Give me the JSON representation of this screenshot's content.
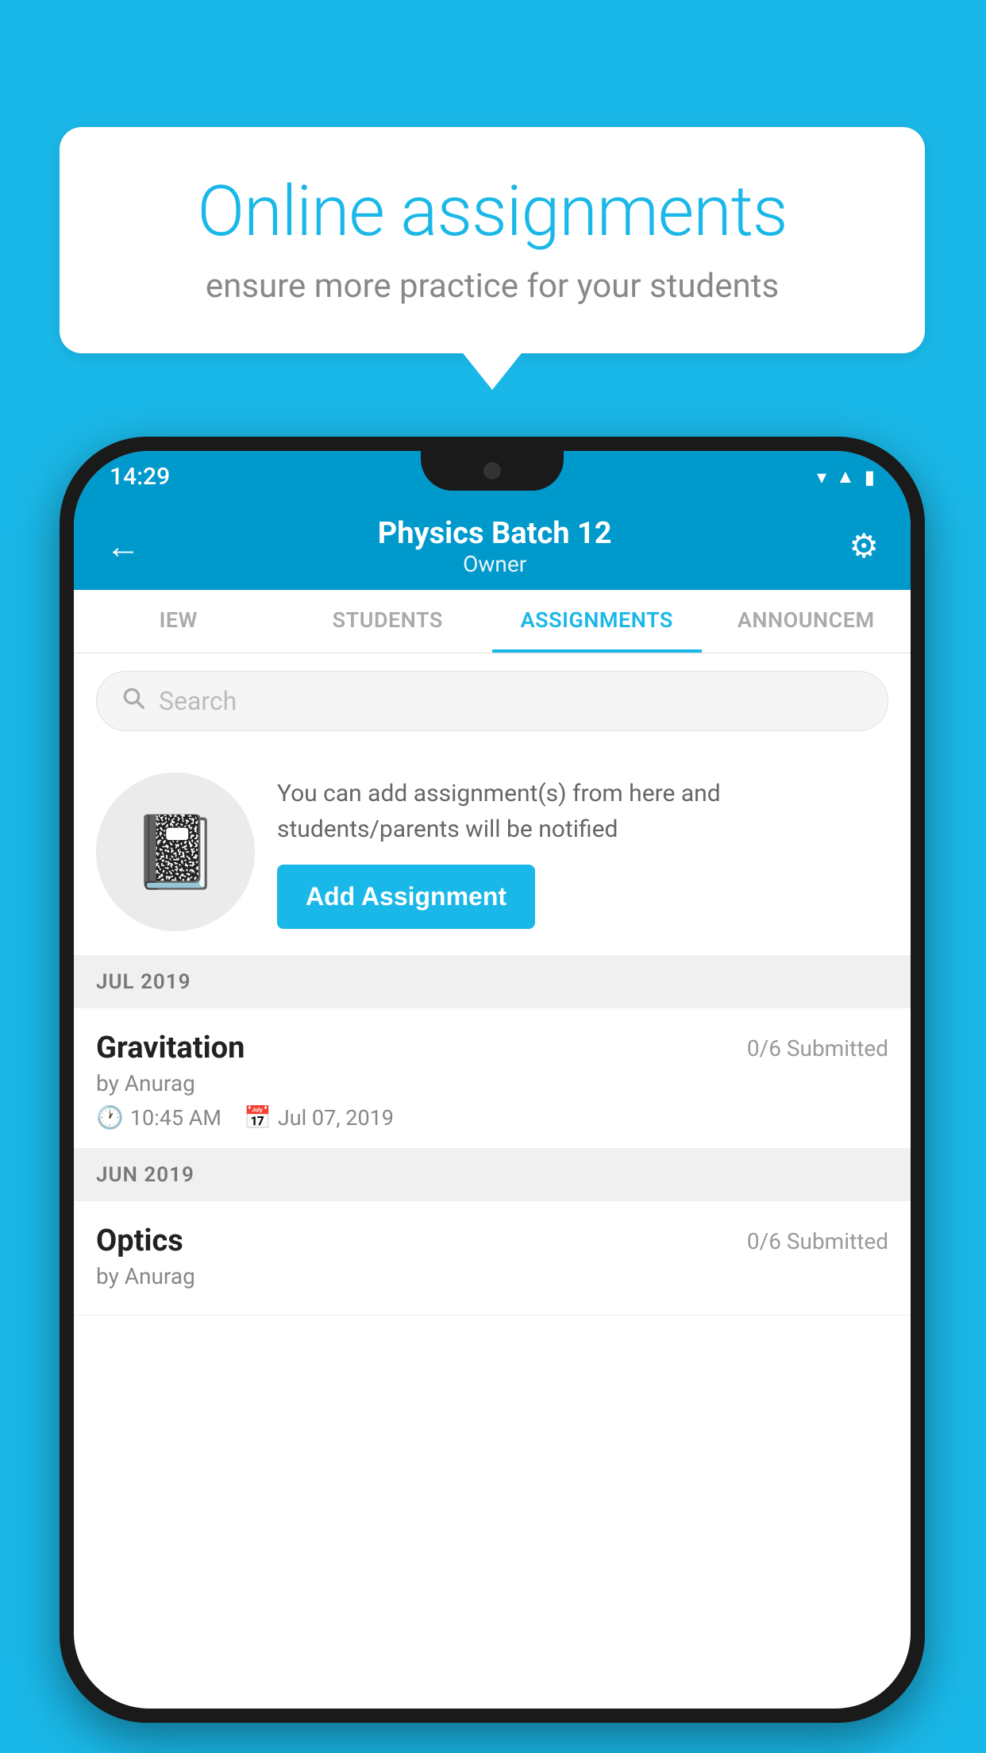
{
  "background_color": "#1ab8e8",
  "speech_bubble": {
    "title": "Online assignments",
    "subtitle": "ensure more practice for your students"
  },
  "status_bar": {
    "time": "14:29",
    "icons": [
      "wifi",
      "signal",
      "battery"
    ]
  },
  "app_header": {
    "title": "Physics Batch 12",
    "subtitle": "Owner",
    "back_label": "←",
    "settings_label": "⚙"
  },
  "tabs": [
    {
      "label": "IEW",
      "active": false
    },
    {
      "label": "STUDENTS",
      "active": false
    },
    {
      "label": "ASSIGNMENTS",
      "active": true
    },
    {
      "label": "ANNOUNCEM",
      "active": false
    }
  ],
  "search": {
    "placeholder": "Search"
  },
  "info_card": {
    "description": "You can add assignment(s) from here and students/parents will be notified",
    "button_label": "Add Assignment"
  },
  "sections": [
    {
      "header": "JUL 2019",
      "assignments": [
        {
          "title": "Gravitation",
          "submitted": "0/6 Submitted",
          "author": "by Anurag",
          "time": "10:45 AM",
          "date": "Jul 07, 2019"
        }
      ]
    },
    {
      "header": "JUN 2019",
      "assignments": [
        {
          "title": "Optics",
          "submitted": "0/6 Submitted",
          "author": "by Anurag",
          "time": "",
          "date": ""
        }
      ]
    }
  ]
}
